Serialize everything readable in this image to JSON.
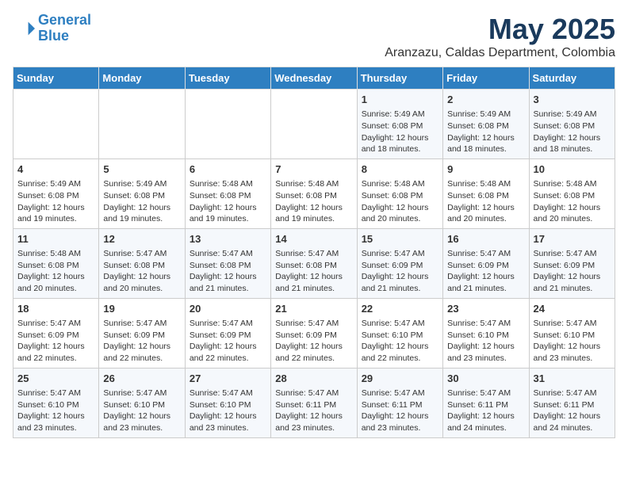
{
  "logo": {
    "line1": "General",
    "line2": "Blue"
  },
  "title": "May 2025",
  "subtitle": "Aranzazu, Caldas Department, Colombia",
  "days_of_week": [
    "Sunday",
    "Monday",
    "Tuesday",
    "Wednesday",
    "Thursday",
    "Friday",
    "Saturday"
  ],
  "weeks": [
    [
      {
        "day": "",
        "content": ""
      },
      {
        "day": "",
        "content": ""
      },
      {
        "day": "",
        "content": ""
      },
      {
        "day": "",
        "content": ""
      },
      {
        "day": "1",
        "content": "Sunrise: 5:49 AM\nSunset: 6:08 PM\nDaylight: 12 hours and 18 minutes."
      },
      {
        "day": "2",
        "content": "Sunrise: 5:49 AM\nSunset: 6:08 PM\nDaylight: 12 hours and 18 minutes."
      },
      {
        "day": "3",
        "content": "Sunrise: 5:49 AM\nSunset: 6:08 PM\nDaylight: 12 hours and 18 minutes."
      }
    ],
    [
      {
        "day": "4",
        "content": "Sunrise: 5:49 AM\nSunset: 6:08 PM\nDaylight: 12 hours and 19 minutes."
      },
      {
        "day": "5",
        "content": "Sunrise: 5:49 AM\nSunset: 6:08 PM\nDaylight: 12 hours and 19 minutes."
      },
      {
        "day": "6",
        "content": "Sunrise: 5:48 AM\nSunset: 6:08 PM\nDaylight: 12 hours and 19 minutes."
      },
      {
        "day": "7",
        "content": "Sunrise: 5:48 AM\nSunset: 6:08 PM\nDaylight: 12 hours and 19 minutes."
      },
      {
        "day": "8",
        "content": "Sunrise: 5:48 AM\nSunset: 6:08 PM\nDaylight: 12 hours and 20 minutes."
      },
      {
        "day": "9",
        "content": "Sunrise: 5:48 AM\nSunset: 6:08 PM\nDaylight: 12 hours and 20 minutes."
      },
      {
        "day": "10",
        "content": "Sunrise: 5:48 AM\nSunset: 6:08 PM\nDaylight: 12 hours and 20 minutes."
      }
    ],
    [
      {
        "day": "11",
        "content": "Sunrise: 5:48 AM\nSunset: 6:08 PM\nDaylight: 12 hours and 20 minutes."
      },
      {
        "day": "12",
        "content": "Sunrise: 5:47 AM\nSunset: 6:08 PM\nDaylight: 12 hours and 20 minutes."
      },
      {
        "day": "13",
        "content": "Sunrise: 5:47 AM\nSunset: 6:08 PM\nDaylight: 12 hours and 21 minutes."
      },
      {
        "day": "14",
        "content": "Sunrise: 5:47 AM\nSunset: 6:08 PM\nDaylight: 12 hours and 21 minutes."
      },
      {
        "day": "15",
        "content": "Sunrise: 5:47 AM\nSunset: 6:09 PM\nDaylight: 12 hours and 21 minutes."
      },
      {
        "day": "16",
        "content": "Sunrise: 5:47 AM\nSunset: 6:09 PM\nDaylight: 12 hours and 21 minutes."
      },
      {
        "day": "17",
        "content": "Sunrise: 5:47 AM\nSunset: 6:09 PM\nDaylight: 12 hours and 21 minutes."
      }
    ],
    [
      {
        "day": "18",
        "content": "Sunrise: 5:47 AM\nSunset: 6:09 PM\nDaylight: 12 hours and 22 minutes."
      },
      {
        "day": "19",
        "content": "Sunrise: 5:47 AM\nSunset: 6:09 PM\nDaylight: 12 hours and 22 minutes."
      },
      {
        "day": "20",
        "content": "Sunrise: 5:47 AM\nSunset: 6:09 PM\nDaylight: 12 hours and 22 minutes."
      },
      {
        "day": "21",
        "content": "Sunrise: 5:47 AM\nSunset: 6:09 PM\nDaylight: 12 hours and 22 minutes."
      },
      {
        "day": "22",
        "content": "Sunrise: 5:47 AM\nSunset: 6:10 PM\nDaylight: 12 hours and 22 minutes."
      },
      {
        "day": "23",
        "content": "Sunrise: 5:47 AM\nSunset: 6:10 PM\nDaylight: 12 hours and 23 minutes."
      },
      {
        "day": "24",
        "content": "Sunrise: 5:47 AM\nSunset: 6:10 PM\nDaylight: 12 hours and 23 minutes."
      }
    ],
    [
      {
        "day": "25",
        "content": "Sunrise: 5:47 AM\nSunset: 6:10 PM\nDaylight: 12 hours and 23 minutes."
      },
      {
        "day": "26",
        "content": "Sunrise: 5:47 AM\nSunset: 6:10 PM\nDaylight: 12 hours and 23 minutes."
      },
      {
        "day": "27",
        "content": "Sunrise: 5:47 AM\nSunset: 6:10 PM\nDaylight: 12 hours and 23 minutes."
      },
      {
        "day": "28",
        "content": "Sunrise: 5:47 AM\nSunset: 6:11 PM\nDaylight: 12 hours and 23 minutes."
      },
      {
        "day": "29",
        "content": "Sunrise: 5:47 AM\nSunset: 6:11 PM\nDaylight: 12 hours and 23 minutes."
      },
      {
        "day": "30",
        "content": "Sunrise: 5:47 AM\nSunset: 6:11 PM\nDaylight: 12 hours and 24 minutes."
      },
      {
        "day": "31",
        "content": "Sunrise: 5:47 AM\nSunset: 6:11 PM\nDaylight: 12 hours and 24 minutes."
      }
    ]
  ]
}
